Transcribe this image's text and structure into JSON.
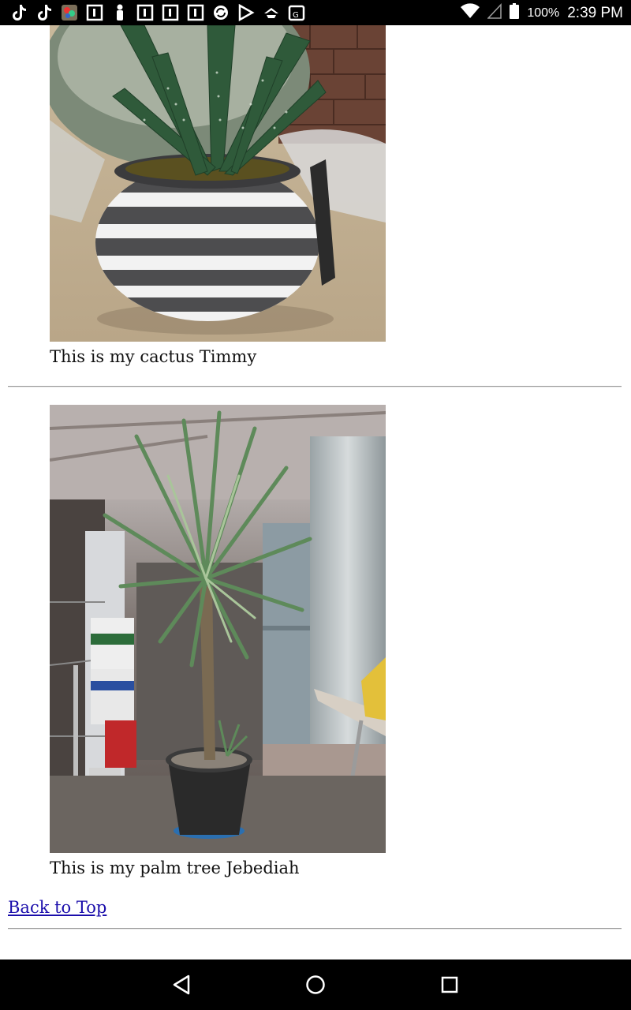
{
  "status_bar": {
    "left_icons": [
      "tiktok-icon",
      "tiktok-icon",
      "gallery-app-icon",
      "notification-square-icon",
      "person-icon",
      "notification-square-icon",
      "notification-square-icon",
      "notification-square-icon",
      "sync-icon",
      "play-store-icon",
      "cloud-icon",
      "maps-icon"
    ],
    "battery_percent": "100%",
    "time": "2:39 PM"
  },
  "posts": [
    {
      "caption": "This is my cactus Timmy"
    },
    {
      "caption": "This is my palm tree Jebediah"
    }
  ],
  "links": {
    "back_to_top": "Back to Top"
  },
  "nav_bar": {
    "buttons": [
      "back-icon",
      "home-icon",
      "recents-icon"
    ]
  },
  "colors": {
    "link": "#1a0dab",
    "status_bar_bg": "#000000"
  }
}
